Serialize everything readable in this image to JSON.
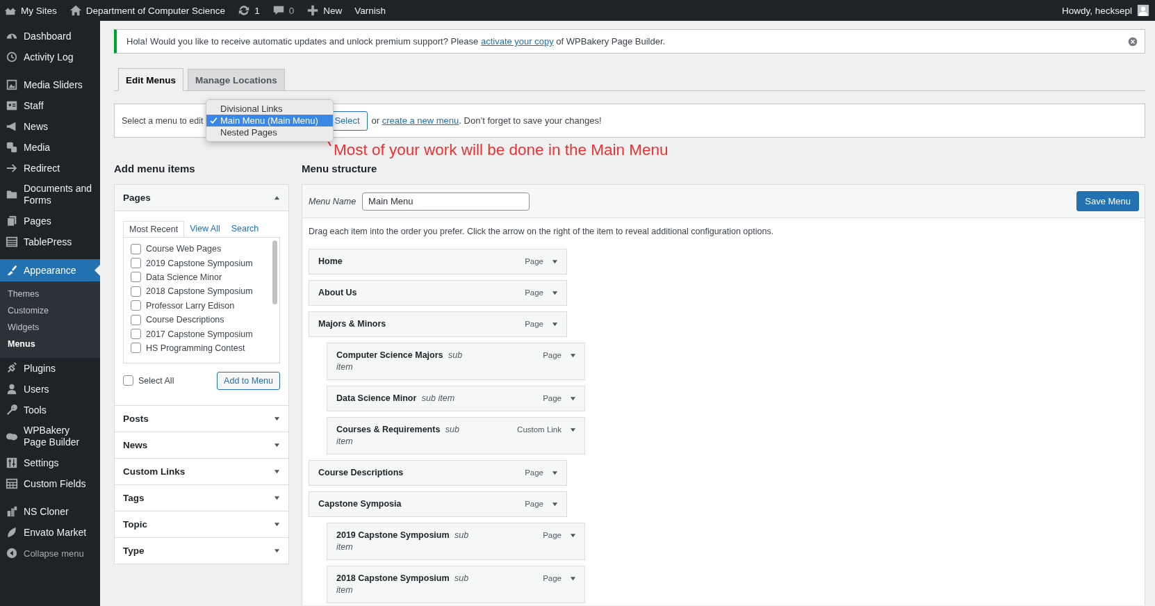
{
  "admin_bar": {
    "items": [
      {
        "kind": "sites",
        "label": "My Sites"
      },
      {
        "kind": "home",
        "label": "Department of Computer Science"
      },
      {
        "kind": "updates",
        "label": "1"
      },
      {
        "kind": "comments",
        "label": "0"
      },
      {
        "kind": "new",
        "label": "New"
      },
      {
        "kind": "plain",
        "label": "Varnish"
      }
    ],
    "greeting": "Howdy, hecksepl"
  },
  "sidebar": {
    "items": [
      {
        "kind": "item",
        "label": "Dashboard",
        "selected": false
      },
      {
        "kind": "item",
        "label": "Activity Log",
        "selected": false
      },
      {
        "kind": "separator"
      },
      {
        "kind": "item",
        "label": "Media Sliders",
        "selected": false
      },
      {
        "kind": "item",
        "label": "Staff",
        "selected": false
      },
      {
        "kind": "item",
        "label": "News",
        "selected": false
      },
      {
        "kind": "item",
        "label": "Media",
        "selected": false
      },
      {
        "kind": "item",
        "label": "Redirect",
        "selected": false
      },
      {
        "kind": "item",
        "label": "Documents and Forms",
        "selected": false
      },
      {
        "kind": "item",
        "label": "Pages",
        "selected": false
      },
      {
        "kind": "item",
        "label": "TablePress",
        "selected": false
      },
      {
        "kind": "separator"
      },
      {
        "kind": "item",
        "label": "Appearance",
        "selected": true,
        "children": [
          {
            "label": "Themes",
            "selected": false
          },
          {
            "label": "Customize",
            "selected": false
          },
          {
            "label": "Widgets",
            "selected": false
          },
          {
            "label": "Menus",
            "selected": true
          }
        ]
      },
      {
        "kind": "item",
        "label": "Plugins",
        "selected": false
      },
      {
        "kind": "item",
        "label": "Users",
        "selected": false
      },
      {
        "kind": "item",
        "label": "Tools",
        "selected": false
      },
      {
        "kind": "item",
        "label": "WPBakery Page Builder",
        "selected": false
      },
      {
        "kind": "item",
        "label": "Settings",
        "selected": false
      },
      {
        "kind": "item",
        "label": "Custom Fields",
        "selected": false
      },
      {
        "kind": "separator"
      },
      {
        "kind": "item",
        "label": "NS Cloner",
        "selected": false
      },
      {
        "kind": "item",
        "label": "Envato Market",
        "selected": false
      },
      {
        "kind": "collapse",
        "label": "Collapse menu"
      }
    ]
  },
  "notice": {
    "text_before": "Hola! Would you like to receive automatic updates and unlock premium support? Please ",
    "link": "activate your copy",
    "text_after": " of WPBakery Page Builder."
  },
  "tabs": [
    {
      "label": "Edit Menus",
      "selected": true
    },
    {
      "label": "Manage Locations",
      "selected": false
    }
  ],
  "menu_picker": {
    "label": "Select a menu to edit",
    "options": [
      {
        "label": "Divisional Links",
        "selected": false
      },
      {
        "label": "Main Menu (Main Menu)",
        "selected": true
      },
      {
        "label": "Nested Pages",
        "selected": false
      }
    ],
    "button": "Select",
    "text_before": "or ",
    "link": "create a new menu",
    "text_after": ". Don’t forget to save your changes!"
  },
  "annotation": {
    "text": "Most of your work will be done in the Main Menu"
  },
  "add_items": {
    "heading": "Add menu items",
    "panels": [
      {
        "title": "Pages",
        "expanded": true,
        "tabs": [
          {
            "label": "Most Recent",
            "selected": true
          },
          {
            "label": "View All",
            "selected": false
          },
          {
            "label": "Search",
            "selected": false
          }
        ],
        "items": [
          {
            "label": "Course Web Pages",
            "checked": false
          },
          {
            "label": "2019 Capstone Symposium",
            "checked": false
          },
          {
            "label": "Data Science Minor",
            "checked": false
          },
          {
            "label": "2018 Capstone Symposium",
            "checked": false
          },
          {
            "label": "Professor Larry Edison",
            "checked": false
          },
          {
            "label": "Course Descriptions",
            "checked": false
          },
          {
            "label": "2017 Capstone Symposium",
            "checked": false
          },
          {
            "label": "HS Programming Contest",
            "checked": false
          }
        ],
        "select_all": {
          "label": "Select All",
          "checked": false
        },
        "button": "Add to Menu"
      },
      {
        "title": "Posts",
        "expanded": false
      },
      {
        "title": "News",
        "expanded": false
      },
      {
        "title": "Custom Links",
        "expanded": false
      },
      {
        "title": "Tags",
        "expanded": false
      },
      {
        "title": "Topic",
        "expanded": false
      },
      {
        "title": "Type",
        "expanded": false
      }
    ]
  },
  "menu_structure": {
    "heading": "Menu structure",
    "name_label": "Menu Name",
    "name_value": "Main Menu",
    "save_button": "Save Menu",
    "instructions": "Drag each item into the order you prefer. Click the arrow on the right of the item to reveal additional configuration options.",
    "items": [
      {
        "title": "Home",
        "type": "Page"
      },
      {
        "title": "About Us",
        "type": "Page"
      },
      {
        "title": "Majors & Minors",
        "type": "Page",
        "children": [
          {
            "title": "Computer Science Majors",
            "note": "sub item",
            "type": "Page"
          },
          {
            "title": "Data Science Minor",
            "note": "sub item",
            "type": "Page"
          },
          {
            "title": "Courses & Requirements",
            "note": "sub item",
            "type": "Custom Link"
          }
        ]
      },
      {
        "title": "Course Descriptions",
        "type": "Page"
      },
      {
        "title": "Capstone Symposia",
        "type": "Page",
        "children": [
          {
            "title": "2019 Capstone Symposium",
            "note": "sub item",
            "type": "Page"
          },
          {
            "title": "2018 Capstone Symposium",
            "note": "sub item",
            "type": "Page"
          }
        ]
      }
    ]
  }
}
